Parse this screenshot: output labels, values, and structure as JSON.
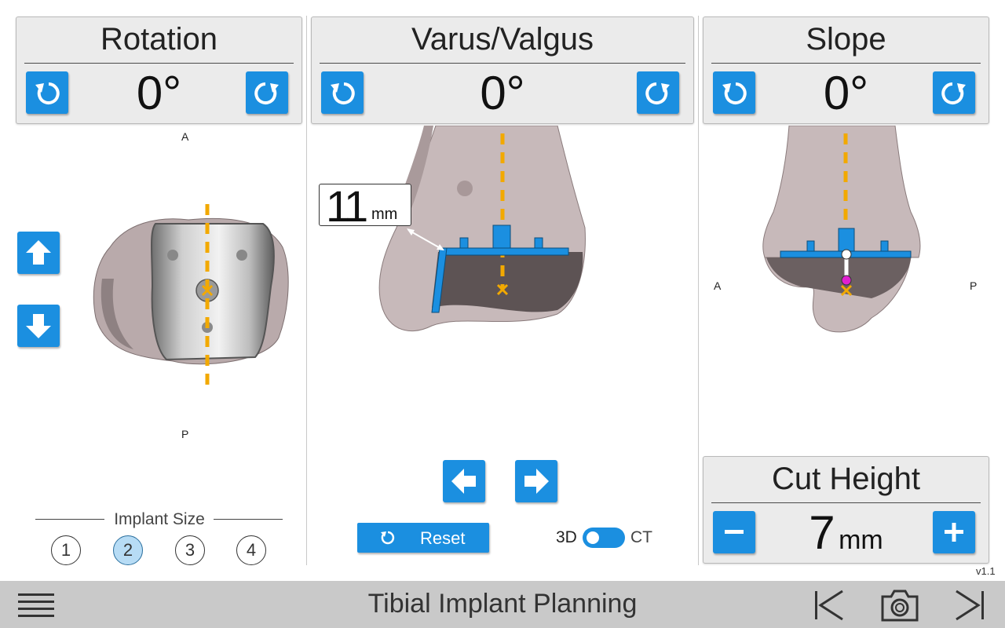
{
  "rotation": {
    "title": "Rotation",
    "value": "0°",
    "ccw_icon": "rotate-ccw-icon",
    "cw_icon": "rotate-cw-icon"
  },
  "varus": {
    "title": "Varus/Valgus",
    "value": "0°"
  },
  "slope": {
    "title": "Slope",
    "value": "0°"
  },
  "orientation": {
    "anterior": "A",
    "posterior": "P"
  },
  "measurement": {
    "value": "11",
    "unit": "mm"
  },
  "implant_size": {
    "label": "Implant Size",
    "sizes": [
      "1",
      "2",
      "3",
      "4"
    ],
    "selected": "2"
  },
  "controls": {
    "reset_label": "Reset",
    "toggle_left": "3D",
    "toggle_right": "CT"
  },
  "cut_height": {
    "title": "Cut Height",
    "value": "7",
    "unit": "mm"
  },
  "version": "v1.1",
  "footer": {
    "title": "Tibial Implant Planning"
  },
  "colors": {
    "accent": "#1b8fe0",
    "guide": "#f2a900",
    "bone": "#c9bcbc",
    "selected": "#b7dcf5"
  }
}
